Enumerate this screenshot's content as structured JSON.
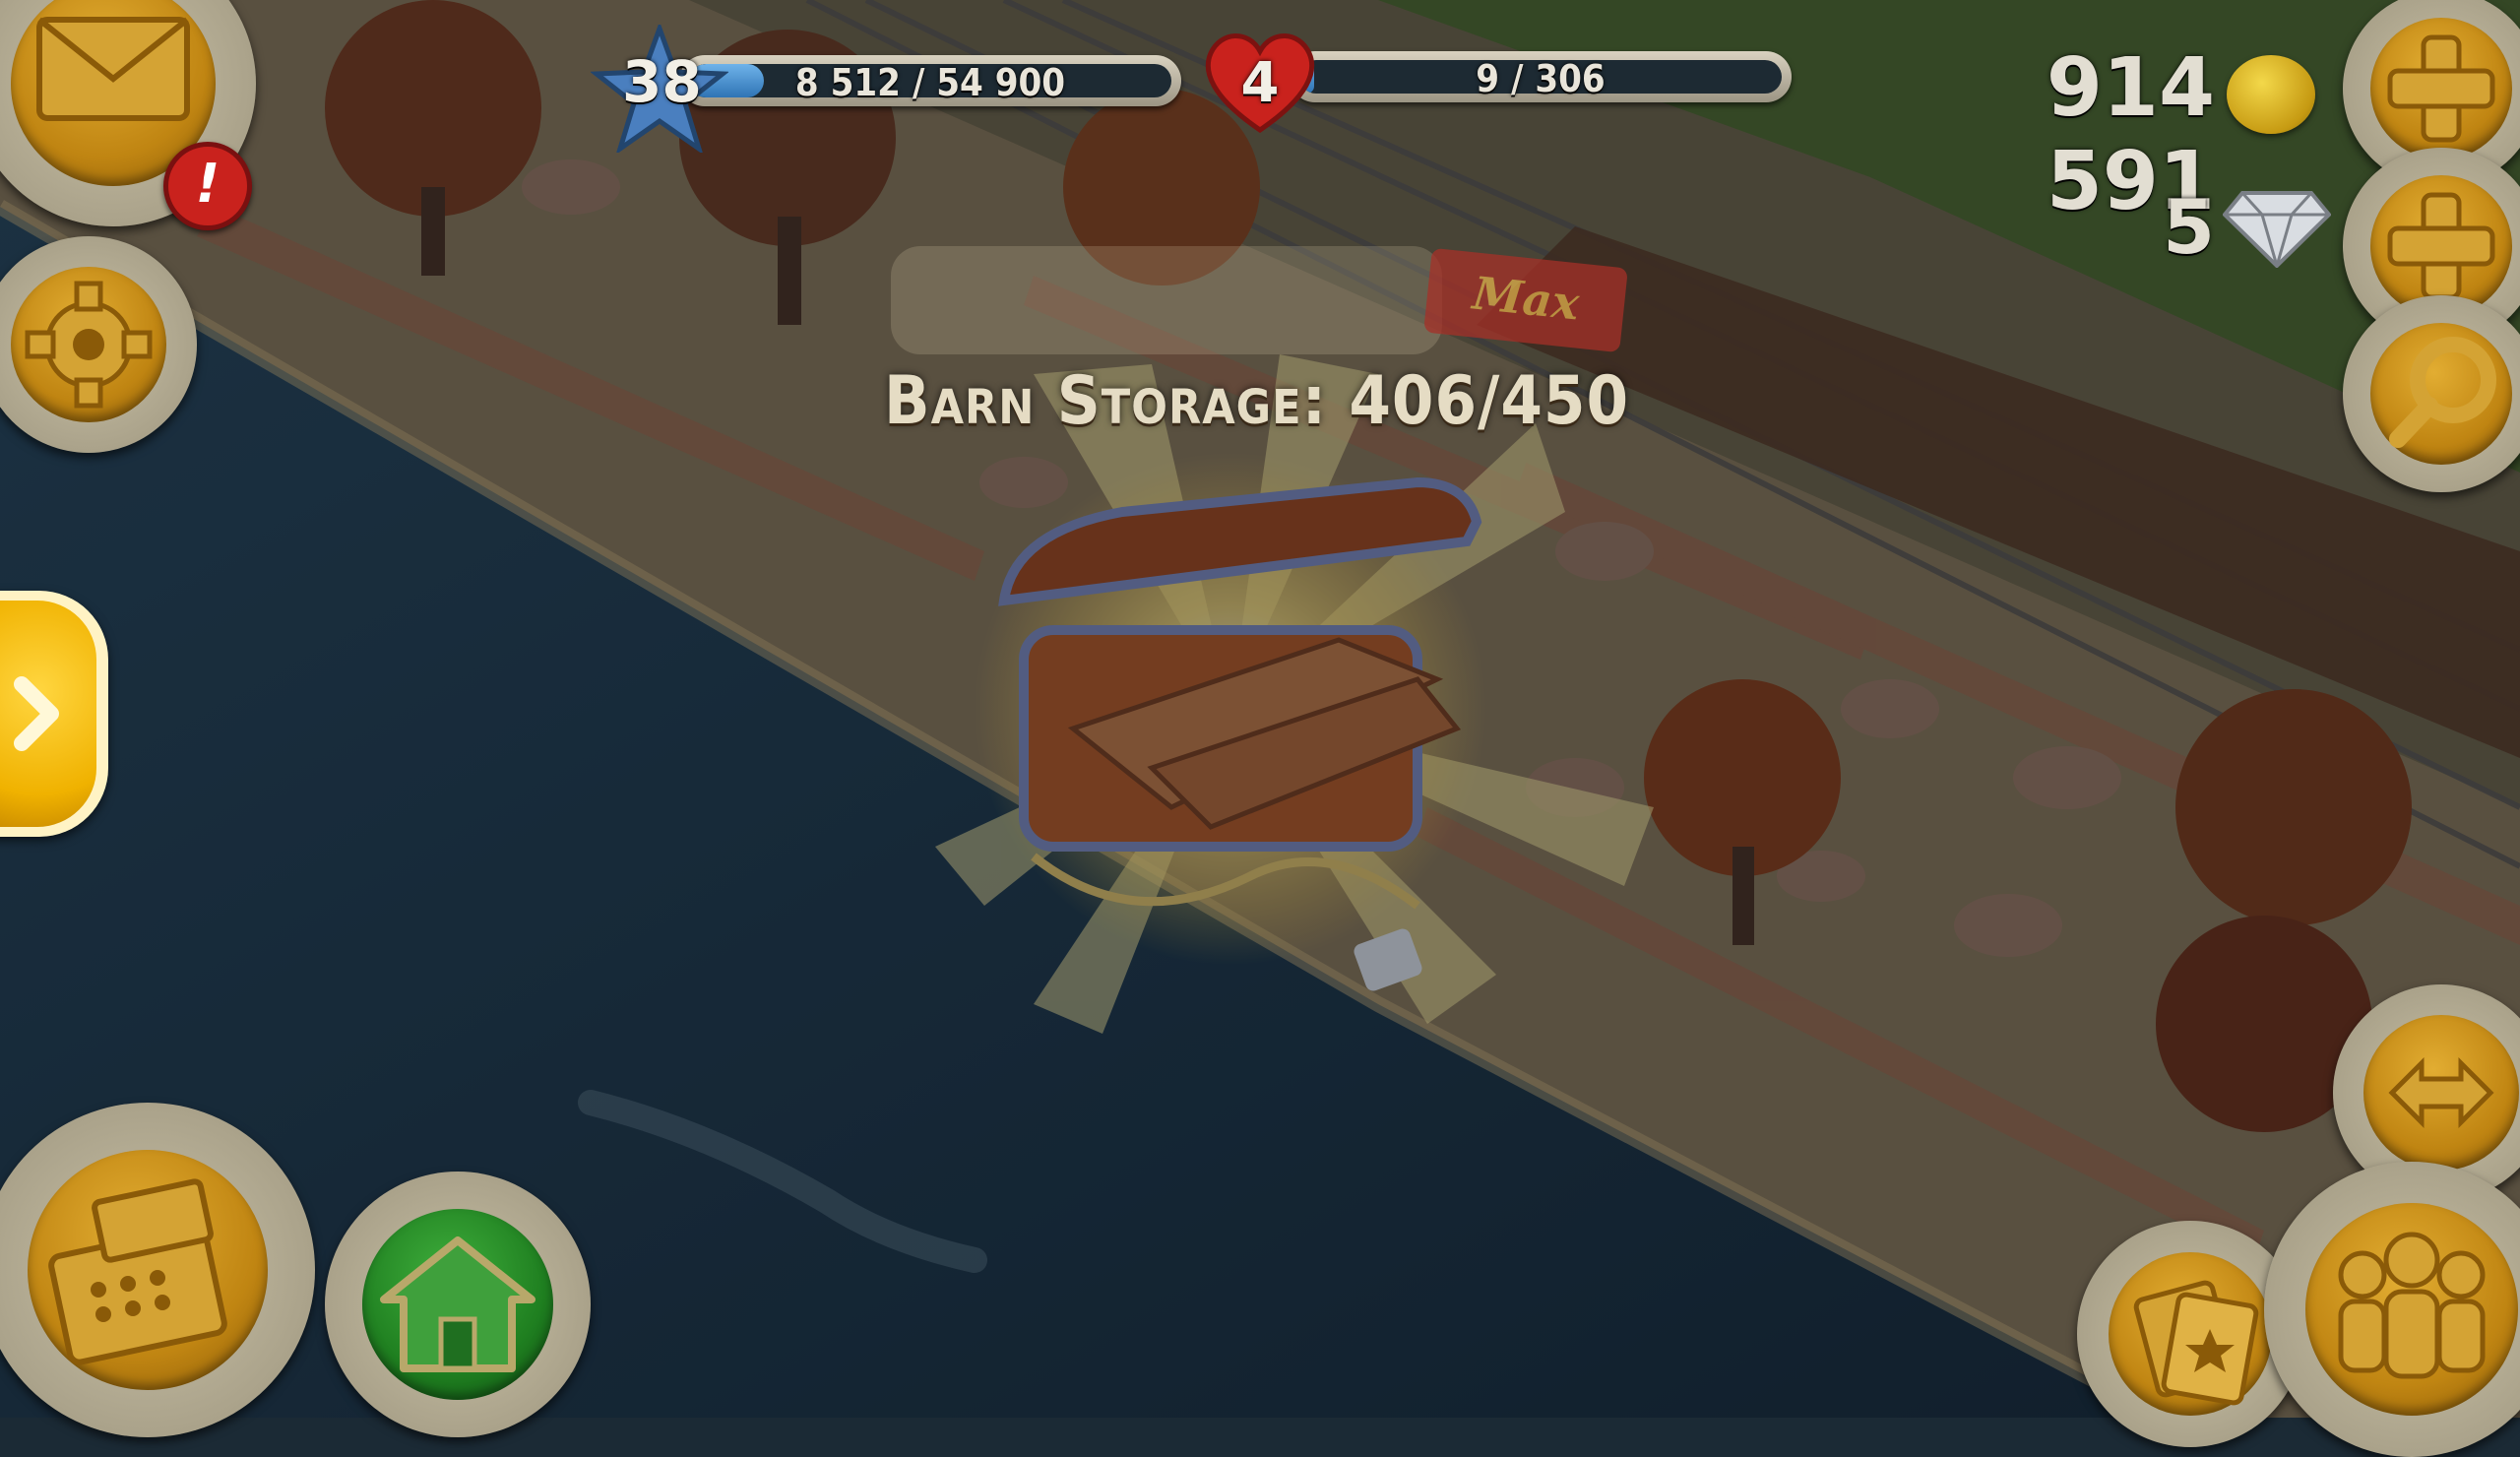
{
  "hud": {
    "level": "38",
    "xp_text": "8 512 / 54 900",
    "xp_progress": 0.155,
    "hearts": "4",
    "reputation_text": "9 / 306",
    "reputation_progress": 0.03,
    "coins": "914 591",
    "diamonds": "5"
  },
  "popup": {
    "storage_label": "Barn Storage: 406/450",
    "max_tag": "Max"
  },
  "mail": {
    "alert": "!"
  },
  "colors": {
    "accent_gold": "#d99a1c",
    "water": "#1d3a4c",
    "sand": "#8a7a5c",
    "heart_red": "#c9221d",
    "star_blue": "#4a7fbf"
  },
  "icons": {
    "mail": "envelope-icon",
    "settings": "gear-icon",
    "expand": "chevron-right-icon",
    "shop": "cash-register-icon",
    "home": "house-icon",
    "add_coins": "plus-icon",
    "add_diamonds": "plus-icon",
    "search": "magnifier-icon",
    "zoom": "expand-arrows-icon",
    "friends": "people-icon",
    "cards": "cards-icon",
    "chest": "treasure-chest-icon"
  }
}
